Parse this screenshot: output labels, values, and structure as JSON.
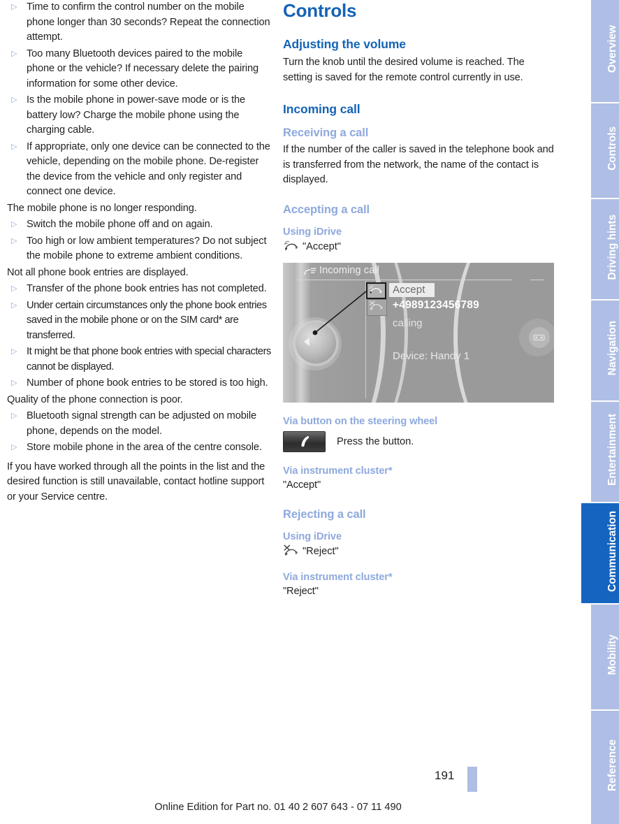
{
  "document": {
    "page_number": "191",
    "footer_note": "Online Edition for Part no. 01 40 2 607 643 - 07 11 490"
  },
  "left_column": {
    "blocks": [
      {
        "kind": "bullet",
        "text": "Time to confirm the control number on the mobile phone longer than 30 seconds? Repeat the connection attempt."
      },
      {
        "kind": "bullet",
        "text": "Too many Bluetooth devices paired to the mobile phone or the vehicle? If necessary delete the pairing information for some other device."
      },
      {
        "kind": "bullet",
        "text": "Is the mobile phone in power-save mode or is the battery low? Charge the mobile phone using the charging cable."
      },
      {
        "kind": "bullet",
        "text": "If appropriate, only one device can be connected to the vehicle, depending on the mobile phone. De-register the device from the vehicle and only register and connect one device."
      },
      {
        "kind": "para",
        "text": "The mobile phone is no longer responding."
      },
      {
        "kind": "bullet",
        "text": "Switch the mobile phone off and on again."
      },
      {
        "kind": "bullet",
        "text": "Too high or low ambient temperatures? Do not subject the mobile phone to extreme ambient conditions."
      },
      {
        "kind": "para",
        "text": "Not all phone book entries are displayed."
      },
      {
        "kind": "bullet",
        "text": "Transfer of the phone book entries has not completed."
      },
      {
        "kind": "bullet",
        "text": "Under certain circumstances only the phone book entries saved in the mobile phone or on the SIM card* are transferred.",
        "tight": true
      },
      {
        "kind": "bullet",
        "text": "It might be that phone book entries with special characters cannot be displayed.",
        "tight": true
      },
      {
        "kind": "bullet",
        "text": "Number of phone book entries to be stored is too high."
      },
      {
        "kind": "para",
        "text": "Quality of the phone connection is poor."
      },
      {
        "kind": "bullet",
        "text": "Bluetooth signal strength can be adjusted on mobile phone, depends on the model."
      },
      {
        "kind": "bullet",
        "text": "Store mobile phone in the area of the centre console."
      },
      {
        "kind": "para",
        "text": "If you have worked through all the points in the list and the desired function is still unavailable, contact hotline support or your Service centre."
      }
    ],
    "bullet_glyph": "▷"
  },
  "right_column": {
    "chapter_title": "Controls",
    "adjusting_volume": {
      "heading": "Adjusting the volume",
      "body": "Turn the knob until the desired volume is reached. The setting is saved for the remote control currently in use."
    },
    "incoming_call": {
      "heading": "Incoming call",
      "receiving": {
        "heading": "Receiving a call",
        "body": "If the number of the caller is saved in the telephone book and is transferred from the network, the name of the contact is displayed."
      },
      "accepting": {
        "heading": "Accepting a call",
        "using_idrive_heading": "Using iDrive",
        "using_idrive_label": "\"Accept\"",
        "using_idrive_icon": "phone-accept-icon",
        "steering_wheel_heading": "Via button on the steering wheel",
        "steering_wheel_text": "Press the button.",
        "steering_wheel_icon": "phone-handset-button-icon",
        "instrument_cluster_heading": "Via instrument cluster*",
        "instrument_cluster_label": "\"Accept\""
      },
      "rejecting": {
        "heading": "Rejecting a call",
        "using_idrive_heading": "Using iDrive",
        "using_idrive_label": "\"Reject\"",
        "using_idrive_icon": "phone-reject-icon",
        "instrument_cluster_heading": "Via instrument cluster*",
        "instrument_cluster_label": "\"Reject\""
      }
    },
    "figure": {
      "title": "Incoming call",
      "title_icon": "call-waves-icon",
      "accept_button": "Accept",
      "phone_number": "+4989123456789",
      "status": "calling",
      "device": "Device: Handy 1",
      "icon_selected": "phone-accept-icon",
      "icon_unselected": "phone-reject-icon",
      "right_icon": "display-toggle-icon"
    }
  },
  "sidebar": {
    "tabs": [
      {
        "label": "Overview",
        "active": false
      },
      {
        "label": "Controls",
        "active": false
      },
      {
        "label": "Driving hints",
        "active": false
      },
      {
        "label": "Navigation",
        "active": false
      },
      {
        "label": "Entertainment",
        "active": false
      },
      {
        "label": "Communication",
        "active": true
      },
      {
        "label": "Mobility",
        "active": false
      },
      {
        "label": "Reference",
        "active": false
      }
    ]
  },
  "colors": {
    "heading_dark_blue": "#1463b6",
    "heading_light_blue": "#8ea9dd",
    "tab_inactive": "#aebee4",
    "tab_active": "#1565c0",
    "body_text": "#231f20"
  }
}
